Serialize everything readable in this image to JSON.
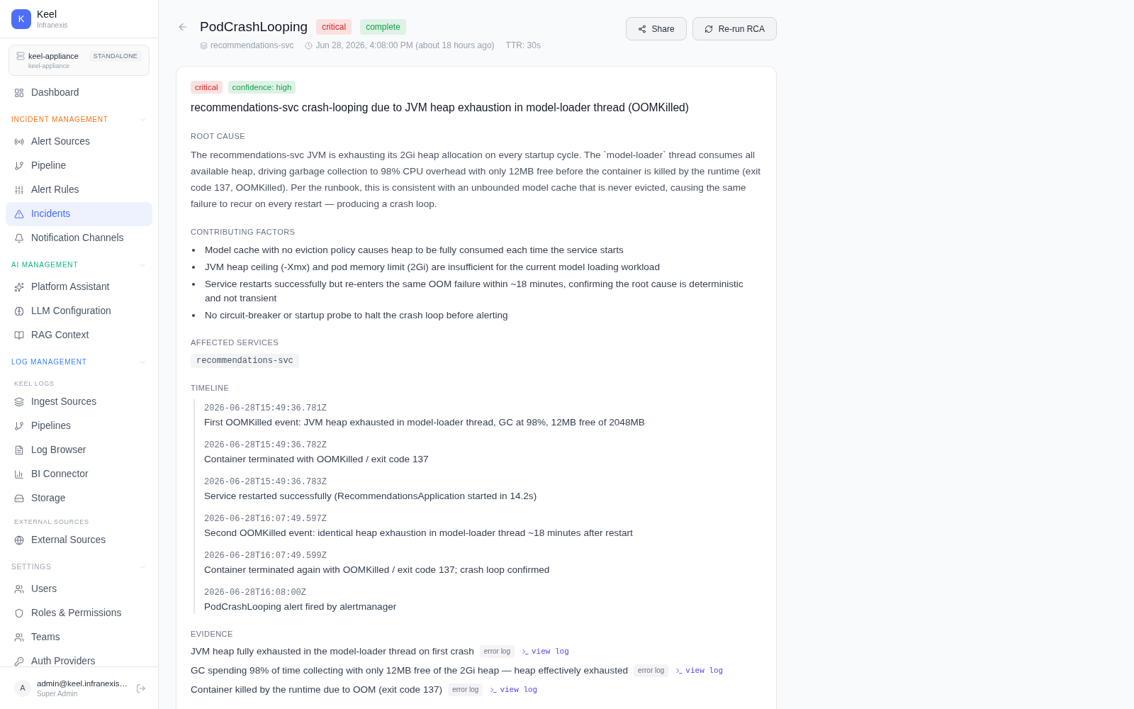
{
  "sidebar": {
    "brand": {
      "logo": "K",
      "name": "Keel",
      "org": "Infranexis"
    },
    "instance": {
      "name": "keel-appliance",
      "mode": "STANDALONE",
      "host": "keel-appliance"
    },
    "nav": {
      "top_items": [
        {
          "label": "Dashboard",
          "selected": false
        }
      ],
      "groups": [
        {
          "title": "INCIDENT MANAGEMENT",
          "color": "#f97316",
          "expanded": true,
          "items": [
            {
              "label": "Alert Sources",
              "selected": false
            },
            {
              "label": "Pipeline",
              "selected": false
            },
            {
              "label": "Alert Rules",
              "selected": false
            },
            {
              "label": "Incidents",
              "selected": true
            },
            {
              "label": "Notification Channels",
              "selected": false
            }
          ]
        },
        {
          "title": "AI MANAGEMENT",
          "color": "#10b981",
          "expanded": true,
          "items": [
            {
              "label": "Platform Assistant",
              "selected": false
            },
            {
              "label": "LLM Configuration",
              "selected": false
            },
            {
              "label": "RAG Context",
              "selected": false
            }
          ]
        },
        {
          "title": "LOG MANAGEMENT",
          "color": "#3b82f6",
          "expanded": true,
          "subgroups": [
            {
              "title": "KEEL LOGS",
              "items": [
                {
                  "label": "Ingest Sources",
                  "selected": false
                },
                {
                  "label": "Pipelines",
                  "selected": false
                },
                {
                  "label": "Log Browser",
                  "selected": false
                },
                {
                  "label": "BI Connector",
                  "selected": false
                },
                {
                  "label": "Storage",
                  "selected": false
                }
              ]
            },
            {
              "title": "EXTERNAL SOURCES",
              "items": [
                {
                  "label": "External Sources",
                  "selected": false
                }
              ]
            }
          ]
        },
        {
          "title": "SETTINGS",
          "color": "#9ca3af",
          "expanded": true,
          "items": [
            {
              "label": "Users",
              "selected": false
            },
            {
              "label": "Roles & Permissions",
              "selected": false
            },
            {
              "label": "Teams",
              "selected": false
            },
            {
              "label": "Auth Providers",
              "selected": false
            }
          ]
        }
      ]
    },
    "user": {
      "avatar": "A",
      "email": "admin@keel.infranexis…",
      "role": "Super Admin"
    }
  },
  "incident": {
    "title": "PodCrashLooping",
    "badges": [
      {
        "label": "critical",
        "color": "#dc2626"
      },
      {
        "label": "complete",
        "color": "#16a34a"
      }
    ],
    "meta": {
      "service": "recommendations-svc",
      "time": "Jun 28, 2026, 4:08:00 PM (about 18 hours ago)",
      "ttr": "TTR: 30s"
    },
    "actions": [
      {
        "label": "Share"
      },
      {
        "label": "Re-run RCA"
      }
    ]
  },
  "rca": {
    "badges": [
      {
        "label": "critical",
        "color": "#dc2626"
      },
      {
        "label": "confidence: high",
        "color": "#16a34a"
      }
    ],
    "summary": "recommendations-svc crash-looping due to JVM heap exhaustion in model-loader thread (OOMKilled)",
    "root_cause": {
      "heading": "ROOT CAUSE",
      "text": "The recommendations-svc JVM is exhausting its 2Gi heap allocation on every startup cycle. The `model-loader` thread consumes all available heap, driving garbage collection to 98% CPU overhead with only 12MB free before the container is killed by the runtime (exit code 137, OOMKilled). Per the runbook, this is consistent with an unbounded model cache that is never evicted, causing the same failure to recur on every restart — producing a crash loop."
    },
    "contributing_factors": {
      "heading": "CONTRIBUTING FACTORS",
      "items": [
        "Model cache with no eviction policy causes heap to be fully consumed each time the service starts",
        "JVM heap ceiling (-Xmx) and pod memory limit (2Gi) are insufficient for the current model loading workload",
        "Service restarts successfully but re-enters the same OOM failure within ~18 minutes, confirming the root cause is deterministic and not transient",
        "No circuit-breaker or startup probe to halt the crash loop before alerting"
      ]
    },
    "affected_services": {
      "heading": "AFFECTED SERVICES",
      "services": [
        "recommendations-svc"
      ]
    },
    "timeline": {
      "heading": "TIMELINE",
      "events": [
        {
          "time": "2026-06-28T15:49:36.781Z",
          "text": "First OOMKilled event: JVM heap exhausted in model-loader thread, GC at 98%, 12MB free of 2048MB"
        },
        {
          "time": "2026-06-28T15:49:36.782Z",
          "text": "Container terminated with OOMKilled / exit code 137"
        },
        {
          "time": "2026-06-28T15:49:36.783Z",
          "text": "Service restarted successfully (RecommendationsApplication started in 14.2s)"
        },
        {
          "time": "2026-06-28T16:07:49.597Z",
          "text": "Second OOMKilled event: identical heap exhaustion in model-loader thread ~18 minutes after restart"
        },
        {
          "time": "2026-06-28T16:07:49.599Z",
          "text": "Container terminated again with OOMKilled / exit code 137; crash loop confirmed"
        },
        {
          "time": "2026-06-28T16:08:00Z",
          "text": "PodCrashLooping alert fired by alertmanager"
        }
      ]
    },
    "evidence": {
      "heading": "EVIDENCE",
      "items": [
        {
          "text": "JVM heap fully exhausted in the model-loader thread on first crash",
          "source": "error log",
          "link": "view log"
        },
        {
          "text": "GC spending 98% of time collecting with only 12MB free of the 2Gi heap — heap effectively exhausted",
          "source": "error log",
          "link": "view log"
        },
        {
          "text": "Container killed by the runtime due to OOM (exit code 137)",
          "source": "error log",
          "link": "view log"
        }
      ]
    }
  }
}
